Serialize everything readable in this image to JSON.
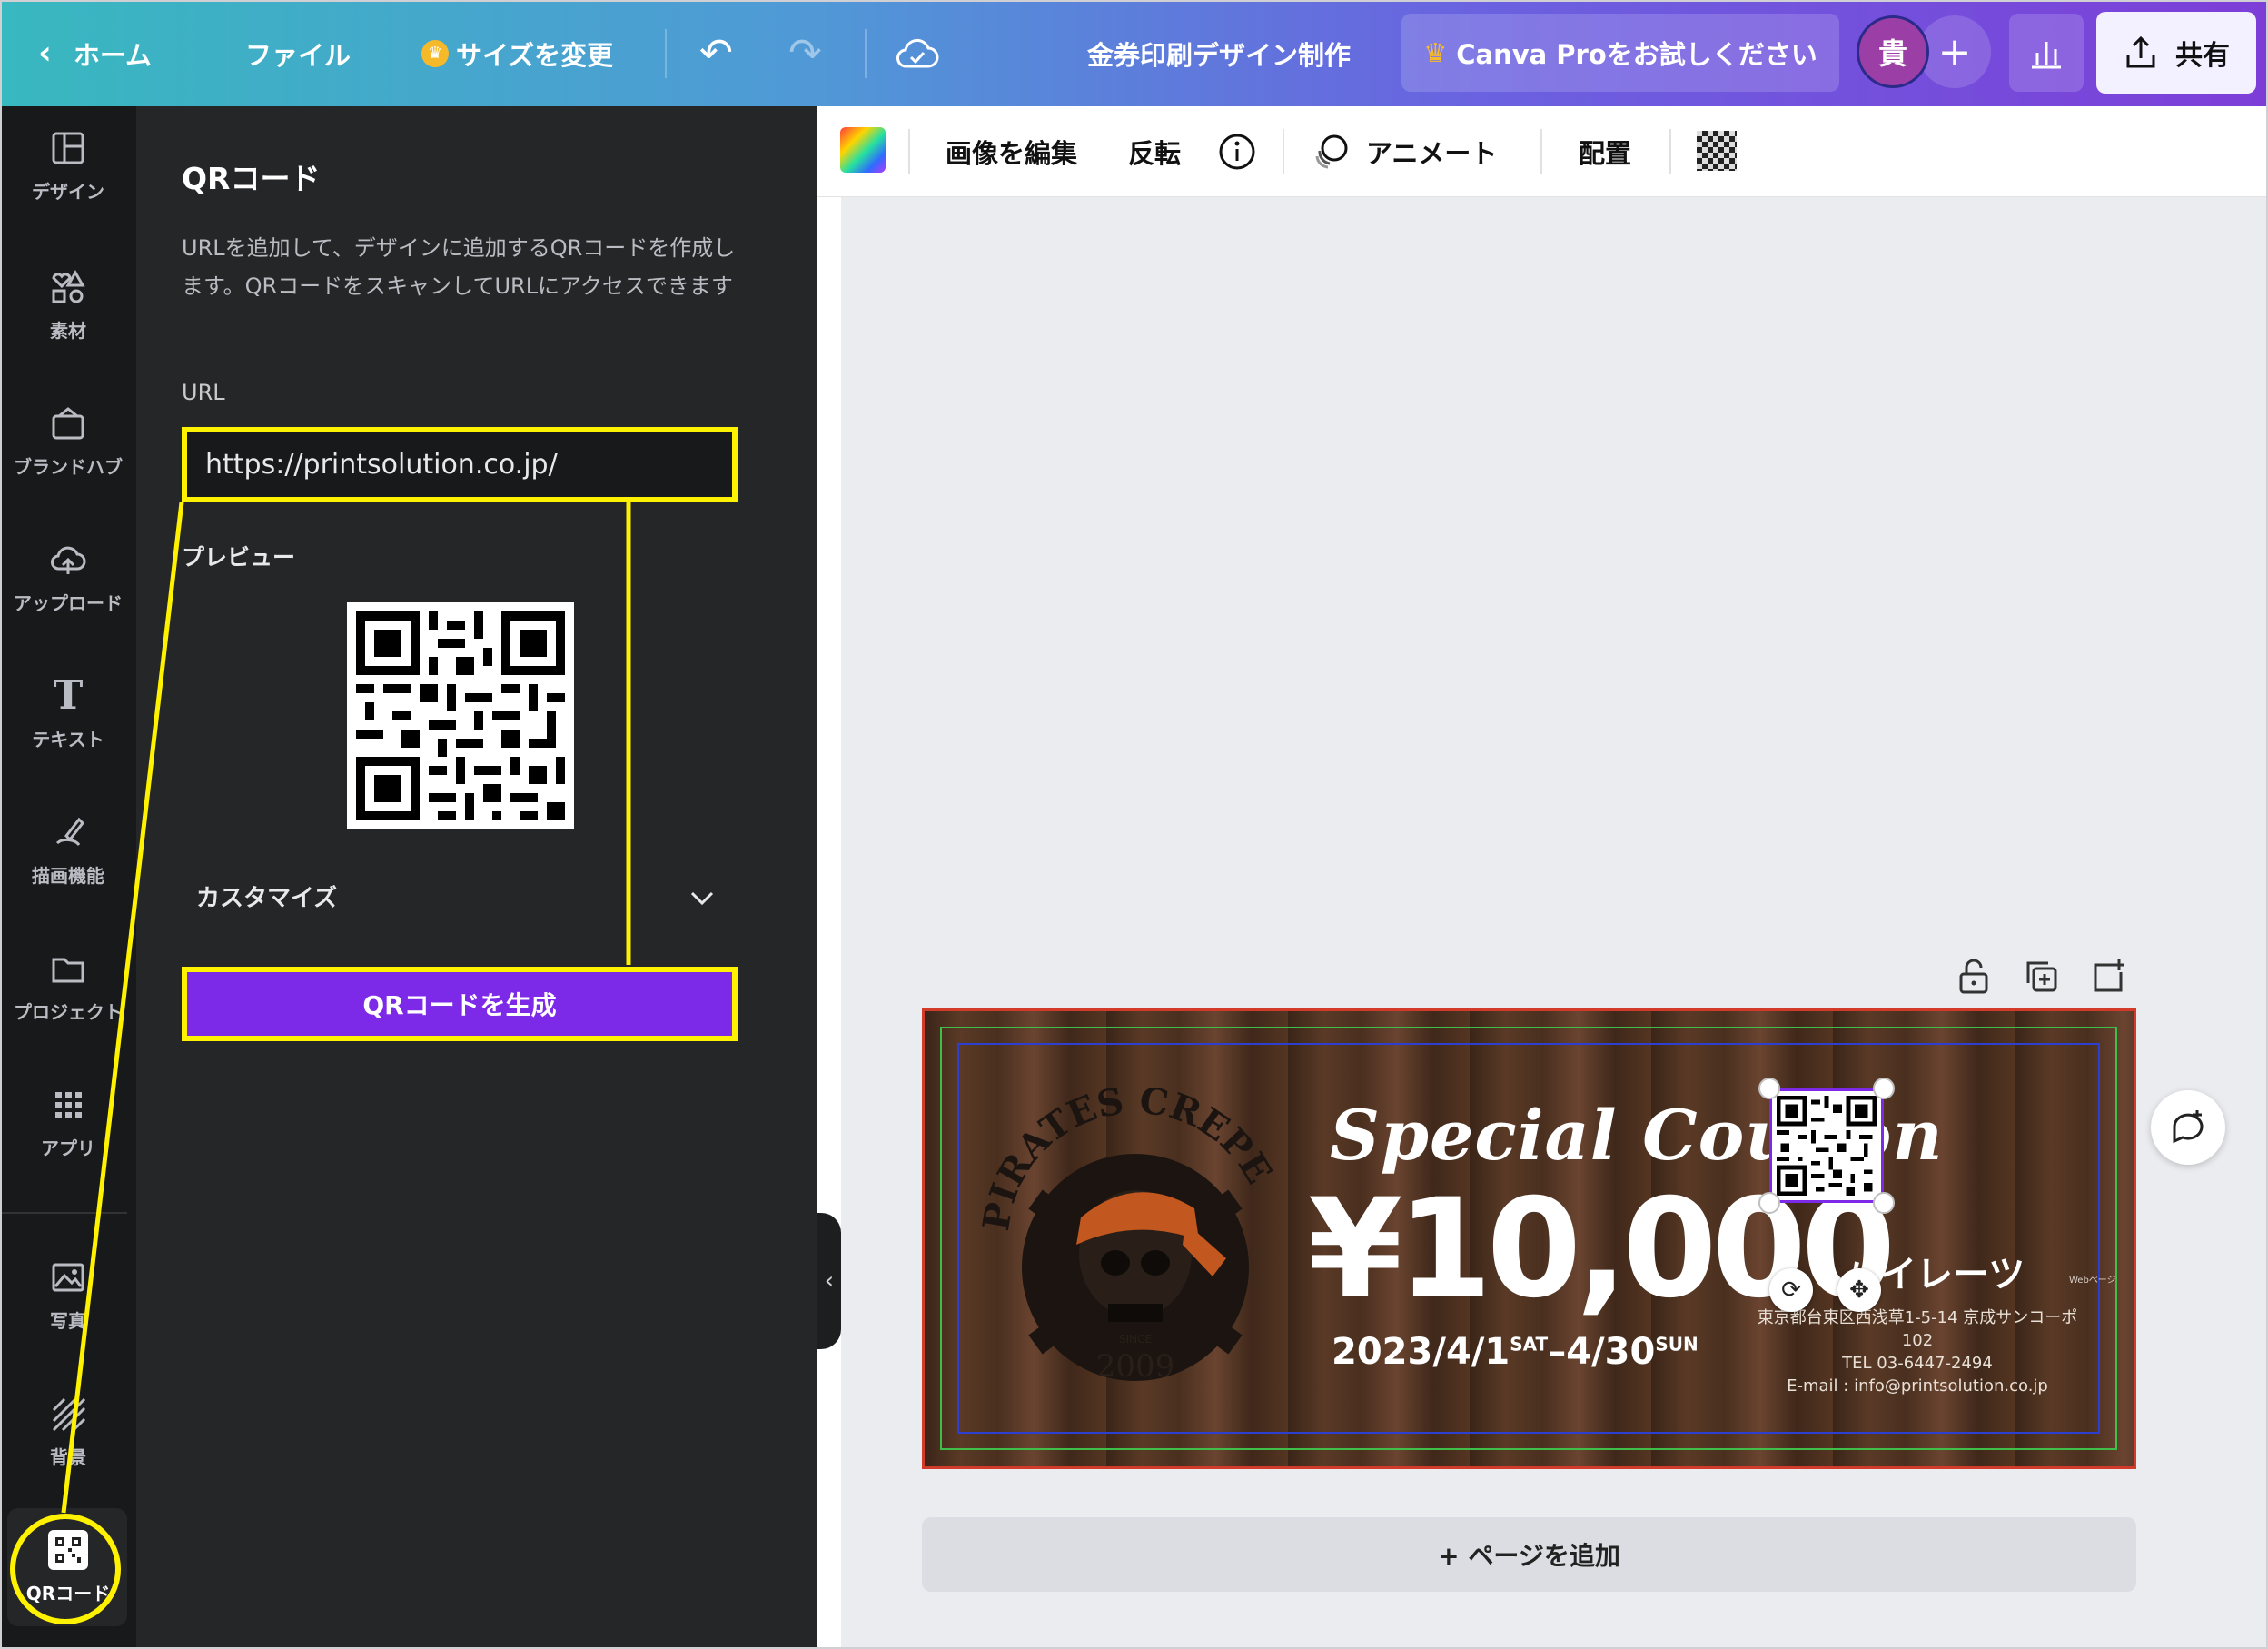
{
  "topbar": {
    "back_label": "ホーム",
    "file_label": "ファイル",
    "resize_label": "サイズを変更",
    "doc_title": "金券印刷デザイン制作",
    "pro_label": "Canva Proをお試しください",
    "avatar_initial": "貴",
    "share_label": "共有"
  },
  "rail": {
    "design": "デザイン",
    "elements": "素材",
    "brand": "ブランドハブ",
    "upload": "アップロード",
    "text": "テキスト",
    "draw": "描画機能",
    "projects": "プロジェクト",
    "apps": "アプリ",
    "photos": "写真",
    "background": "背景",
    "qr": "QRコード"
  },
  "panel": {
    "title": "QRコード",
    "description": "URLを追加して、デザインに追加するQRコードを作成します。QRコードをスキャンしてURLにアクセスできます",
    "url_label": "URL",
    "url_value": "https://printsolution.co.jp/",
    "preview_label": "プレビュー",
    "customize_label": "カスタマイズ",
    "generate_label": "QRコードを生成"
  },
  "context_bar": {
    "edit_image": "画像を編集",
    "flip": "反転",
    "animate": "アニメート",
    "position": "配置"
  },
  "coupon": {
    "brand_text": "PIRATES CREPE",
    "since": "SINCE",
    "year": "2009",
    "headline": "Special Coupon",
    "amount": "¥10,000",
    "date_start": "2023/4/1",
    "date_start_day": "SAT",
    "date_end": "–4/30",
    "date_end_day": "SUN",
    "shop_name": "パイレーツ",
    "web_label": "Webページ",
    "address": "東京都台東区西浅草1-5-14 京成サンコーポ102",
    "tel": "TEL 03-6447-2494",
    "email": "E-mail : info@printsolution.co.jp"
  },
  "canvas": {
    "add_page_label": "+ ページを追加"
  },
  "colors": {
    "accent": "#7d2ae8",
    "highlight": "#fff200",
    "panel_bg": "#252627",
    "rail_bg": "#18191b"
  }
}
